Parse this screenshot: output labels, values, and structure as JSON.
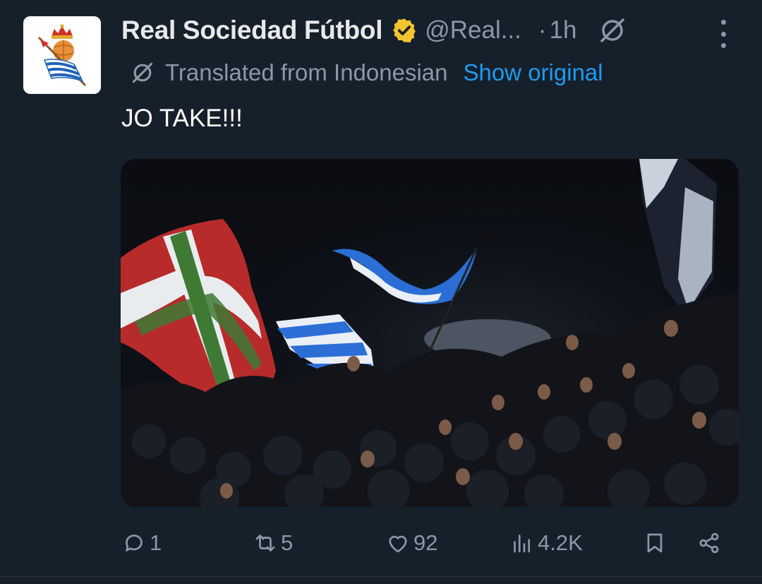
{
  "account": {
    "name": "Real Sociedad Fútbol",
    "handle": "@Real...",
    "separator": "·",
    "time": "1h",
    "verified_color": "#f4c430",
    "avatar_icon": "real-sociedad-crest"
  },
  "translation": {
    "label": "Translated from Indonesian",
    "link": "Show original",
    "link_color": "#1d9bf0"
  },
  "post": {
    "text": "JO TAKE!!!"
  },
  "media": {
    "subject": "fans-in-stands-waving-flags"
  },
  "actions": {
    "reply_count": "1",
    "repost_count": "5",
    "like_count": "92",
    "view_count": "4.2K"
  },
  "theme": {
    "background": "#15202b",
    "text_primary": "#e7e9ea",
    "text_secondary": "#8b98a5"
  }
}
